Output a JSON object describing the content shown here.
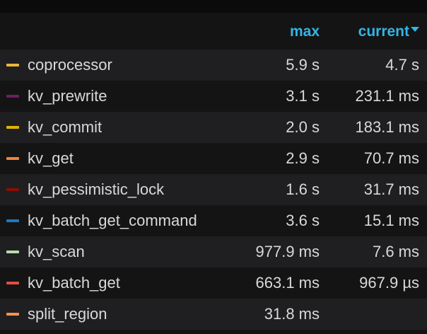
{
  "legend": {
    "columns": {
      "max": "max",
      "current": "current"
    },
    "sort_icon": "caret-down-icon",
    "series": [
      {
        "name": "coprocessor",
        "color": "#eab839",
        "max": "5.9 s",
        "current": "4.7 s"
      },
      {
        "name": "kv_prewrite",
        "color": "#6d1f62",
        "max": "3.1 s",
        "current": "231.1 ms"
      },
      {
        "name": "kv_commit",
        "color": "#e0b400",
        "max": "2.0 s",
        "current": "183.1 ms"
      },
      {
        "name": "kv_get",
        "color": "#ef843c",
        "max": "2.9 s",
        "current": "70.7 ms"
      },
      {
        "name": "kv_pessimistic_lock",
        "color": "#890f02",
        "max": "1.6 s",
        "current": "31.7 ms"
      },
      {
        "name": "kv_batch_get_command",
        "color": "#1f78c1",
        "max": "3.6 s",
        "current": "15.1 ms"
      },
      {
        "name": "kv_scan",
        "color": "#b7dbab",
        "max": "977.9 ms",
        "current": "7.6 ms"
      },
      {
        "name": "kv_batch_get",
        "color": "#e24d42",
        "max": "663.1 ms",
        "current": "967.9 µs"
      },
      {
        "name": "split_region",
        "color": "#f9934e",
        "max": "31.8 ms",
        "current": ""
      }
    ]
  }
}
